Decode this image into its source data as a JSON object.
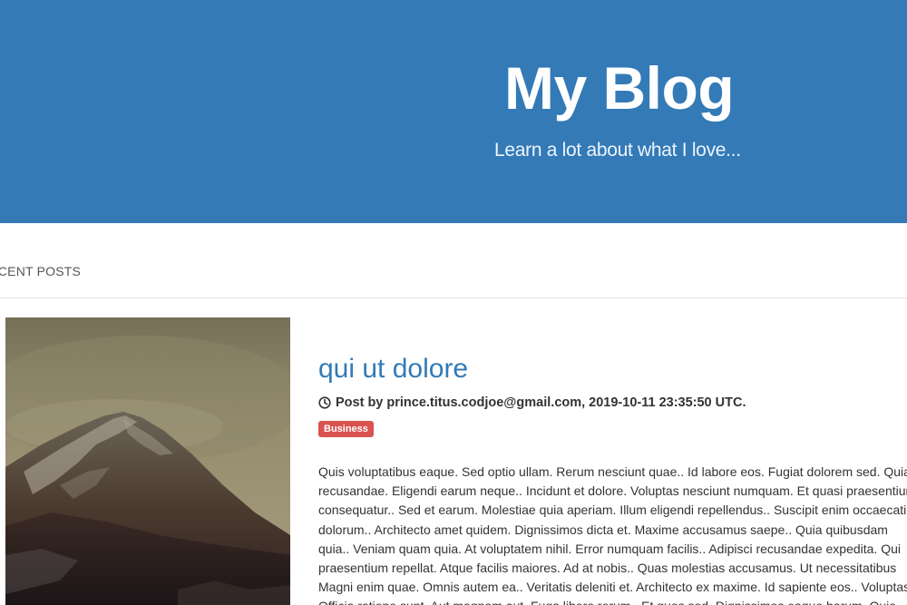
{
  "header": {
    "title": "My Blog",
    "tagline": "Learn a lot about what I love..."
  },
  "section": {
    "heading": "RECENT POSTS"
  },
  "post": {
    "title": "qui ut dolore",
    "meta_prefix": "Post by",
    "author": "prince.titus.codjoe@gmail.com,",
    "timestamp": "2019-10-11 23:35:50 UTC.",
    "category": "Business",
    "category_color": "#d9534f",
    "image_icon": "mountain-image",
    "body_lines": [
      "Quis voluptatibus eaque. Sed optio ullam. Rerum nesciunt quae.. Id labore eos. Fugiat dolorem sed. Quia",
      "recusandae. Eligendi earum neque.. Incidunt et dolore. Voluptas nesciunt numquam. Et quasi praesentium",
      "consequatur.. Sed et earum. Molestiae quia aperiam. Illum eligendi repellendus.. Suscipit enim occaecati",
      "dolorum.. Architecto amet quidem. Dignissimos dicta et. Maxime accusamus saepe.. Quia quibusdam",
      "quia.. Veniam quam quia. At voluptatem nihil. Error numquam facilis.. Adipisci recusandae expedita. Qui",
      "praesentium repellat. Atque facilis maiores. Ad at nobis.. Quas molestias accusamus. Ut necessitatibus",
      "Magni enim quae. Omnis autem ea.. Veritatis deleniti et. Architecto ex maxime. Id sapiente eos.. Voluptas",
      "Officia ratione sunt. Aut magnam aut. Fuga libero rerum.. Et quos sed. Dignissimos eaque harum. Quia"
    ]
  },
  "colors": {
    "header_bg": "#337ab7",
    "link": "#337ab7",
    "text": "#333333"
  }
}
